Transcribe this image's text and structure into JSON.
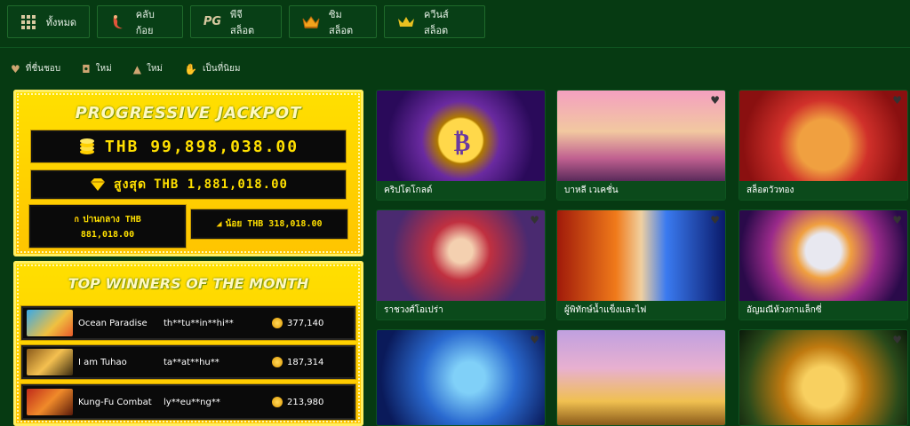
{
  "tabs": [
    {
      "label": "ทั้งหมด",
      "icon": "grid-icon"
    },
    {
      "label": "คลับก้อย",
      "icon": "mermaid-icon"
    },
    {
      "label": "พีจี สล็อต",
      "icon": "pg-logo-icon"
    },
    {
      "label": "ซิมสล็อต",
      "icon": "crown-icon"
    },
    {
      "label": "ควีนส์ สล็อต",
      "icon": "queen-crown-icon"
    }
  ],
  "filters": [
    {
      "label": "ที่ชื่นชอบ",
      "icon": "heart-icon"
    },
    {
      "label": "ใหม่",
      "icon": "bag-icon"
    },
    {
      "label": "ใหม่",
      "icon": "fire-icon"
    },
    {
      "label": "เป็นที่นิยม",
      "icon": "thumbs-up-icon"
    }
  ],
  "jackpot": {
    "title": "PROGRESSIVE JACKPOT",
    "main": "THB 99,898,038.00",
    "max_label": "สูงสุด",
    "max_value": "THB 1,881,018.00",
    "mid_label": "ปานกลาง THB",
    "mid_value": "881,018.00",
    "low_label": "น้อย THB",
    "low_value": "318,018.00"
  },
  "top_winners": {
    "title": "TOP WINNERS OF THE MONTH",
    "rows": [
      {
        "game": "Ocean Paradise",
        "user": "th**tu**in**hi**",
        "amount": "377,140"
      },
      {
        "game": "I am Tuhao",
        "user": "ta**at**hu**",
        "amount": "187,314"
      },
      {
        "game": "Kung-Fu Combat",
        "user": "ly**eu**ng**",
        "amount": "213,980"
      }
    ]
  },
  "games": [
    {
      "name": "คริปโตโกลด์"
    },
    {
      "name": "บาหลี เวเคชั่น"
    },
    {
      "name": "สล็อตวัวทอง"
    },
    {
      "name": "ราชวงศ์โอเปร่า"
    },
    {
      "name": "ผู้พิทักษ์น้ำแข็งและไฟ"
    },
    {
      "name": "อัญมณีห้วงกาแล็กซี่"
    },
    {
      "name": ""
    },
    {
      "name": ""
    },
    {
      "name": ""
    }
  ]
}
